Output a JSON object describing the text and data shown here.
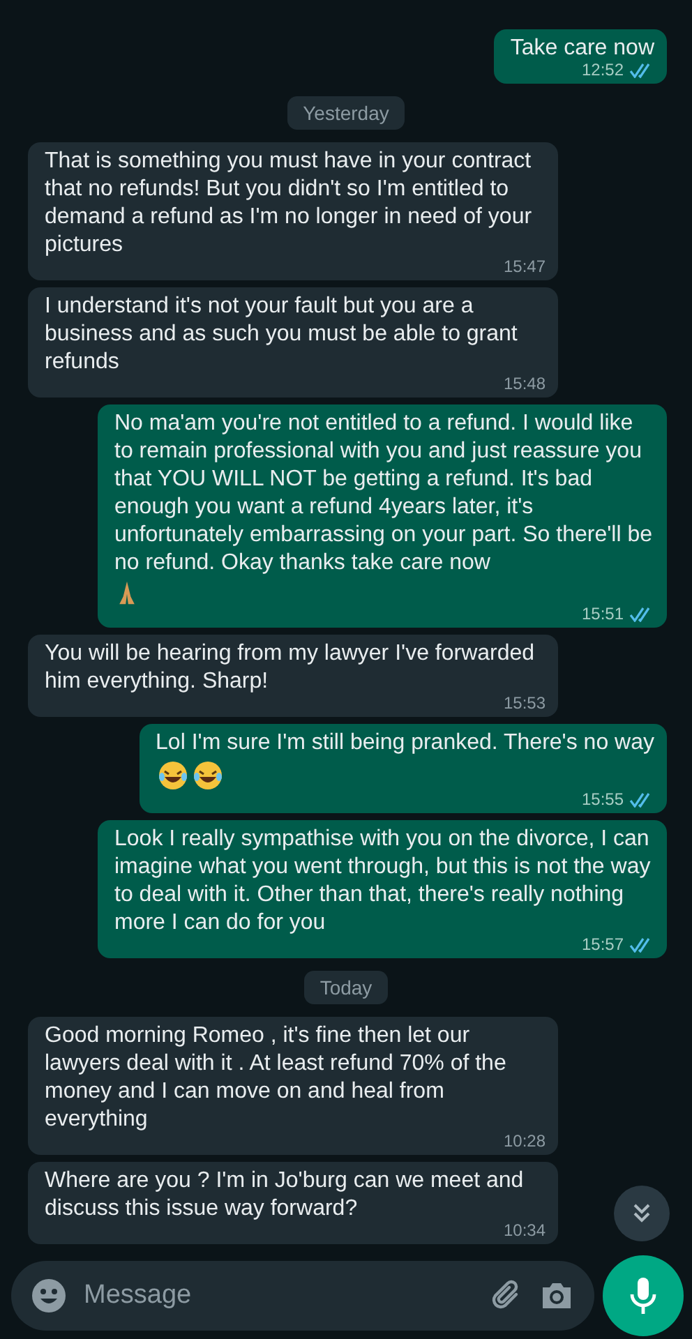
{
  "messages": [
    {
      "kind": "out",
      "text": "Take care now",
      "time": "12:52",
      "read": true
    },
    {
      "kind": "date",
      "text": "Yesterday"
    },
    {
      "kind": "in",
      "text": "That is something you must have in your contract that no refunds! But you didn't so I'm entitled to demand a refund as I'm no longer in need of your pictures",
      "time": "15:47"
    },
    {
      "kind": "in",
      "text": "I understand it's not your fault but you are a business and as such you must be able to grant refunds",
      "time": "15:48"
    },
    {
      "kind": "out",
      "text": "No ma'am you're not entitled to a refund. I would like to remain professional with you and just reassure you that YOU WILL NOT be getting a refund. It's bad enough you want a refund 4years later, it's unfortunately embarrassing on your part. So there'll be no refund. Okay thanks take care now",
      "emoji": [
        {
          "kind": "pray"
        }
      ],
      "time": "15:51",
      "read": true
    },
    {
      "kind": "in",
      "text": "You will be hearing from my lawyer I've forwarded him everything. Sharp!",
      "time": "15:53"
    },
    {
      "kind": "out",
      "text": "Lol I'm sure I'm still being pranked. There's no way",
      "emoji": [
        {
          "kind": "laugh"
        },
        {
          "kind": "laugh"
        }
      ],
      "time": "15:55",
      "read": true
    },
    {
      "kind": "out",
      "text": "Look I really sympathise with you on the divorce, I can imagine what you went through, but this is not the way to deal with it. Other than that, there's really nothing more  I can do for you",
      "time": "15:57",
      "read": true
    },
    {
      "kind": "date",
      "text": "Today"
    },
    {
      "kind": "in",
      "text": "Good morning Romeo , it's fine then let our lawyers deal with it . At least refund 70% of the money and I can move on and heal from everything",
      "time": "10:28"
    },
    {
      "kind": "in",
      "text": "Where are you ? I'm in Jo'burg can we meet and discuss this issue way forward?",
      "time": "10:34"
    }
  ],
  "composer": {
    "placeholder": "Message"
  }
}
